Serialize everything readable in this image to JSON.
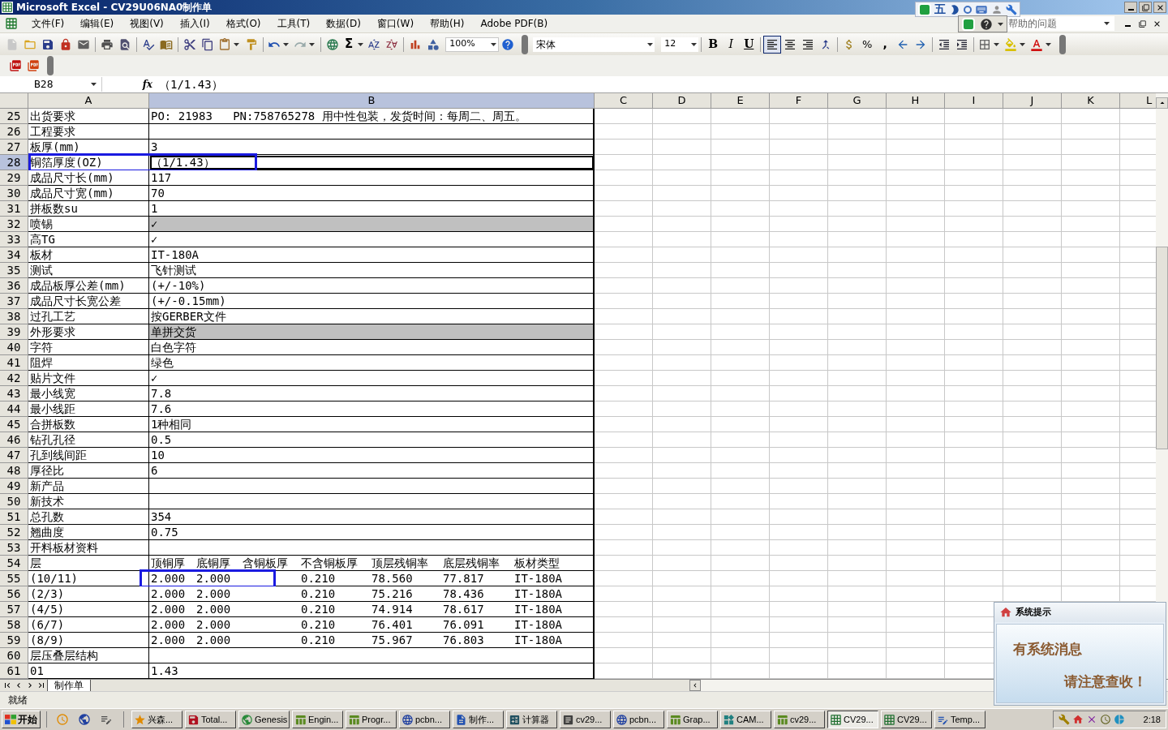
{
  "window": {
    "title": "Microsoft Excel - CV29U06NA0制作单"
  },
  "menu": [
    "文件(F)",
    "编辑(E)",
    "视图(V)",
    "插入(I)",
    "格式(O)",
    "工具(T)",
    "数据(D)",
    "窗口(W)",
    "帮助(H)",
    "Adobe PDF(B)"
  ],
  "ime_bar": {
    "layout": "五"
  },
  "help_box": {
    "placeholder": "帮助的问题"
  },
  "toolbar": {
    "autosum": "Σ",
    "zoom": "100%",
    "font": "宋体",
    "font_size": "12",
    "bold": "B",
    "italic": "I",
    "underline": "U",
    "percent": "%",
    "comma": ","
  },
  "align_buttons": [
    {
      "kind": "left",
      "selected": true
    },
    {
      "kind": "center",
      "selected": false
    },
    {
      "kind": "right",
      "selected": false
    }
  ],
  "formula_bar": {
    "name_box": "B28",
    "fx": "fx",
    "formula": "（1/1.43）"
  },
  "columns": [
    {
      "label": "A",
      "selected": false
    },
    {
      "label": "B",
      "selected": true
    },
    {
      "label": "C",
      "selected": false
    },
    {
      "label": "D",
      "selected": false
    },
    {
      "label": "E",
      "selected": false
    },
    {
      "label": "F",
      "selected": false
    },
    {
      "label": "G",
      "selected": false
    },
    {
      "label": "H",
      "selected": false
    },
    {
      "label": "I",
      "selected": false
    },
    {
      "label": "J",
      "selected": false
    },
    {
      "label": "K",
      "selected": false
    },
    {
      "label": "L",
      "selected": false
    }
  ],
  "rows": [
    {
      "kind": "field",
      "num": "25",
      "selected": false,
      "boxed": false,
      "shaded": false,
      "a": "出货要求",
      "b": "PO: 21983   PN:758765278 用中性包装，发货时间：每周二、周五。"
    },
    {
      "kind": "field",
      "num": "26",
      "selected": false,
      "boxed": false,
      "shaded": false,
      "a": "工程要求"
    },
    {
      "kind": "field",
      "num": "27",
      "selected": false,
      "boxed": false,
      "shaded": false,
      "a": "板厚(mm)",
      "b": "3"
    },
    {
      "kind": "field",
      "num": "28",
      "selected": true,
      "boxed": true,
      "shaded": false,
      "a": "铜箔厚度(OZ)",
      "b": "（1/1.43）"
    },
    {
      "kind": "field",
      "num": "29",
      "selected": false,
      "boxed": false,
      "shaded": false,
      "a": "成品尺寸长(mm)",
      "b": "117"
    },
    {
      "kind": "field",
      "num": "30",
      "selected": false,
      "boxed": false,
      "shaded": false,
      "a": "成品尺寸宽(mm)",
      "b": "70"
    },
    {
      "kind": "field",
      "num": "31",
      "selected": false,
      "boxed": false,
      "shaded": false,
      "a": "拼板数su",
      "b": "1"
    },
    {
      "kind": "field",
      "num": "32",
      "selected": false,
      "boxed": false,
      "shaded": true,
      "a": "喷锡",
      "b": "✓"
    },
    {
      "kind": "field",
      "num": "33",
      "selected": false,
      "boxed": false,
      "shaded": false,
      "a": "高TG",
      "b": "✓"
    },
    {
      "kind": "field",
      "num": "34",
      "selected": false,
      "boxed": false,
      "shaded": false,
      "a": "板材",
      "b": "IT-180A"
    },
    {
      "kind": "field",
      "num": "35",
      "selected": false,
      "boxed": false,
      "shaded": false,
      "a": "测试",
      "b": "飞针测试"
    },
    {
      "kind": "field",
      "num": "36",
      "selected": false,
      "boxed": false,
      "shaded": false,
      "a": "成品板厚公差(mm)",
      "b": "(+/-10%)"
    },
    {
      "kind": "field",
      "num": "37",
      "selected": false,
      "boxed": false,
      "shaded": false,
      "a": "成品尺寸长宽公差",
      "b": "(+/-0.15mm)"
    },
    {
      "kind": "field",
      "num": "38",
      "selected": false,
      "boxed": false,
      "shaded": false,
      "a": "过孔工艺",
      "b": "按GERBER文件"
    },
    {
      "kind": "field",
      "num": "39",
      "selected": false,
      "boxed": false,
      "shaded": true,
      "a": "外形要求",
      "b": "单拼交货"
    },
    {
      "kind": "field",
      "num": "40",
      "selected": false,
      "boxed": false,
      "shaded": false,
      "a": "字符",
      "b": "白色字符"
    },
    {
      "kind": "field",
      "num": "41",
      "selected": false,
      "boxed": false,
      "shaded": false,
      "a": "阻焊",
      "b": "绿色"
    },
    {
      "kind": "field",
      "num": "42",
      "selected": false,
      "boxed": false,
      "shaded": false,
      "a": "贴片文件",
      "b": "✓"
    },
    {
      "kind": "field",
      "num": "43",
      "selected": false,
      "boxed": false,
      "shaded": false,
      "a": "最小线宽",
      "b": "7.8"
    },
    {
      "kind": "field",
      "num": "44",
      "selected": false,
      "boxed": false,
      "shaded": false,
      "a": "最小线距",
      "b": "7.6"
    },
    {
      "kind": "field",
      "num": "45",
      "selected": false,
      "boxed": false,
      "shaded": false,
      "a": "合拼板数",
      "b": "1种相同"
    },
    {
      "kind": "field",
      "num": "46",
      "selected": false,
      "boxed": false,
      "shaded": false,
      "a": "钻孔孔径",
      "b": "0.5"
    },
    {
      "kind": "field",
      "num": "47",
      "selected": false,
      "boxed": false,
      "shaded": false,
      "a": "孔到线间距",
      "b": "10"
    },
    {
      "kind": "field",
      "num": "48",
      "selected": false,
      "boxed": false,
      "shaded": false,
      "a": "厚径比",
      "b": "6"
    },
    {
      "kind": "field",
      "num": "49",
      "selected": false,
      "boxed": false,
      "shaded": false,
      "a": "新产品"
    },
    {
      "kind": "field",
      "num": "50",
      "selected": false,
      "boxed": false,
      "shaded": false,
      "a": "新技术"
    },
    {
      "kind": "field",
      "num": "51",
      "selected": false,
      "boxed": false,
      "shaded": false,
      "a": "总孔数",
      "b": "354"
    },
    {
      "kind": "field",
      "num": "52",
      "selected": false,
      "boxed": false,
      "shaded": false,
      "a": "翘曲度",
      "b": "0.75"
    },
    {
      "kind": "field",
      "num": "53",
      "selected": false,
      "boxed": false,
      "shaded": false,
      "a": "开料板材资料"
    },
    {
      "kind": "layer_header",
      "num": "54",
      "selected": false,
      "boxed": false,
      "shaded": false,
      "a": "层",
      "headers": [
        "顶铜厚",
        "底铜厚",
        "含铜板厚",
        "不含铜板厚",
        "顶层残铜率",
        "底层残铜率",
        "板材类型"
      ]
    },
    {
      "kind": "layer",
      "num": "55",
      "selected": false,
      "boxed": true,
      "shaded": false,
      "a": "(10/11)",
      "top_copper": "2.000",
      "bottom_copper": "2.000",
      "core": "0.210",
      "top_residual": "78.560",
      "bottom_residual": "77.817",
      "material": "IT-180A"
    },
    {
      "kind": "layer",
      "num": "56",
      "selected": false,
      "boxed": false,
      "shaded": false,
      "a": "(2/3)",
      "top_copper": "2.000",
      "bottom_copper": "2.000",
      "core": "0.210",
      "top_residual": "75.216",
      "bottom_residual": "78.436",
      "material": "IT-180A"
    },
    {
      "kind": "layer",
      "num": "57",
      "selected": false,
      "boxed": false,
      "shaded": false,
      "a": "(4/5)",
      "top_copper": "2.000",
      "bottom_copper": "2.000",
      "core": "0.210",
      "top_residual": "74.914",
      "bottom_residual": "78.617",
      "material": "IT-180A"
    },
    {
      "kind": "layer",
      "num": "58",
      "selected": false,
      "boxed": false,
      "shaded": false,
      "a": "(6/7)",
      "top_copper": "2.000",
      "bottom_copper": "2.000",
      "core": "0.210",
      "top_residual": "76.401",
      "bottom_residual": "76.091",
      "material": "IT-180A"
    },
    {
      "kind": "layer",
      "num": "59",
      "selected": false,
      "boxed": false,
      "shaded": false,
      "a": "(8/9)",
      "top_copper": "2.000",
      "bottom_copper": "2.000",
      "core": "0.210",
      "top_residual": "75.967",
      "bottom_residual": "76.803",
      "material": "IT-180A"
    },
    {
      "kind": "field",
      "num": "60",
      "selected": false,
      "boxed": false,
      "shaded": false,
      "a": "层压叠层结构"
    },
    {
      "kind": "field",
      "num": "61",
      "selected": false,
      "boxed": false,
      "shaded": false,
      "a": "01",
      "b": "1.43"
    }
  ],
  "sheet_tabs": [
    {
      "label": "制作单",
      "selected": true
    }
  ],
  "status_bar": {
    "text": "就绪"
  },
  "taskbar": {
    "start": "开始",
    "tasks": [
      {
        "label": "兴森...",
        "selected": false
      },
      {
        "label": "Total...",
        "selected": false
      },
      {
        "label": "Genesis",
        "selected": false
      },
      {
        "label": "Engin...",
        "selected": false
      },
      {
        "label": "Progr...",
        "selected": false
      },
      {
        "label": "pcbn...",
        "selected": false
      },
      {
        "label": "制作...",
        "selected": false
      },
      {
        "label": "计算器",
        "selected": false
      },
      {
        "label": "cv29...",
        "selected": false
      },
      {
        "label": "pcbn...",
        "selected": false
      },
      {
        "label": "Grap...",
        "selected": false
      },
      {
        "label": "CAM...",
        "selected": false
      },
      {
        "label": "cv29...",
        "selected": false
      },
      {
        "label": "CV29...",
        "selected": true
      },
      {
        "label": "CV29...",
        "selected": false
      },
      {
        "label": "Temp...",
        "selected": false
      }
    ],
    "time": "2:18"
  },
  "notification": {
    "title": "系统提示",
    "line_1": "有系统消息",
    "line_2": "请注意查收！"
  }
}
